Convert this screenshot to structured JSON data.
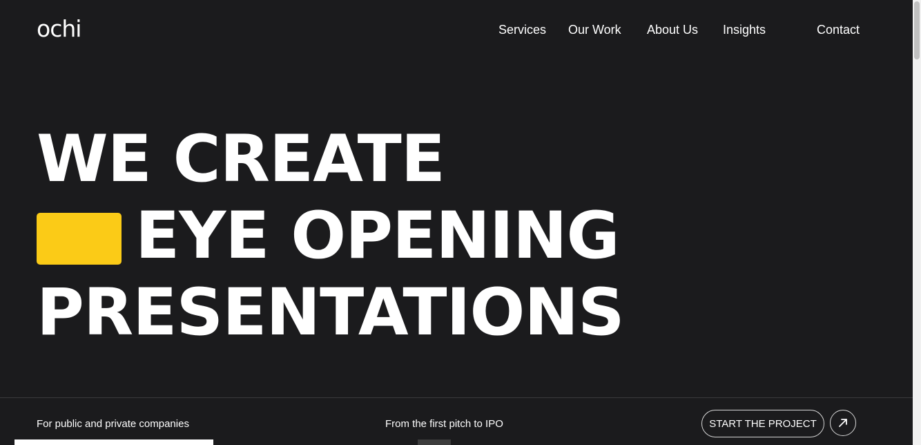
{
  "brand": {
    "logo_text": "ochi"
  },
  "nav": {
    "items": [
      {
        "label": "Services"
      },
      {
        "label": "Our Work"
      },
      {
        "label": "About Us"
      },
      {
        "label": "Insights"
      },
      {
        "label": "Contact"
      }
    ]
  },
  "hero": {
    "line1": "WE CREATE",
    "line2": "EYE OPENING",
    "line3": "PRESENTATIONS",
    "accent_color": "#fbcb17"
  },
  "footer_strip": {
    "tagline_left": "For public and private companies",
    "tagline_middle": "From the first pitch to IPO",
    "cta_label": "START THE PROJECT",
    "cta_icon": "arrow-up-right-icon"
  },
  "colors": {
    "background": "#1b1b1d",
    "text": "#ffffff"
  }
}
